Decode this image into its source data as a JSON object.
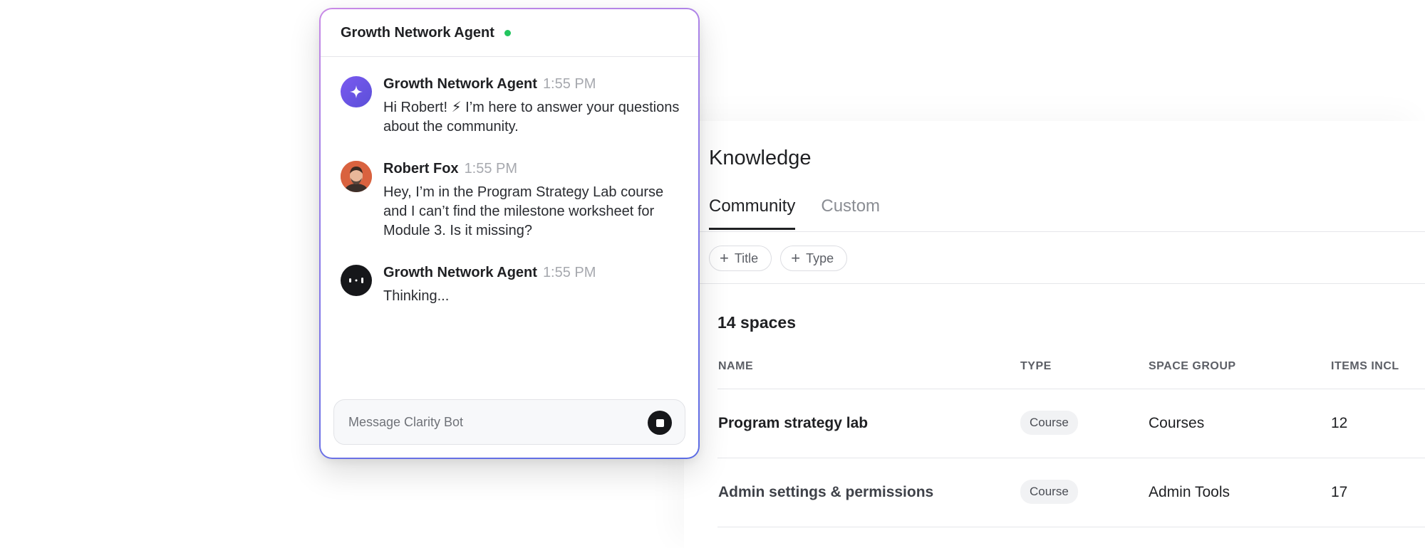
{
  "chat": {
    "title": "Growth Network Agent",
    "status_color": "#22c55e",
    "accent_gradient": [
      "#c98ae6",
      "#8b7be8",
      "#5b6ce4"
    ],
    "messages": [
      {
        "sender": "Growth Network Agent",
        "time": "1:55 PM",
        "avatar": "sparkle-icon",
        "text": "Hi Robert! ⚡ I’m here to answer your questions about the community."
      },
      {
        "sender": "Robert Fox",
        "time": "1:55 PM",
        "avatar": "user-photo",
        "text": "Hey, I’m in the Program Strategy Lab course and I can’t find the milestone worksheet for Module 3. Is it missing?"
      },
      {
        "sender": "Growth Network Agent",
        "time": "1:55 PM",
        "avatar": "typing-dots-icon",
        "text": "Thinking..."
      }
    ],
    "composer": {
      "placeholder": "Message Clarity Bot",
      "value": "",
      "stop_icon": "stop-icon"
    }
  },
  "knowledge": {
    "title": "Knowledge",
    "tabs": [
      {
        "label": "Community",
        "active": true
      },
      {
        "label": "Custom",
        "active": false
      }
    ],
    "filters": [
      {
        "label": "Title",
        "icon": "plus-icon"
      },
      {
        "label": "Type",
        "icon": "plus-icon"
      }
    ],
    "count_label": "14 spaces",
    "table": {
      "columns": [
        "NAME",
        "TYPE",
        "SPACE GROUP",
        "ITEMS INCL"
      ],
      "rows": [
        {
          "name": "Program strategy lab",
          "type": "Course",
          "space_group": "Courses",
          "items": "12"
        },
        {
          "name": "Admin settings & permissions",
          "type": "Course",
          "space_group": "Admin Tools",
          "items": "17"
        }
      ]
    }
  }
}
